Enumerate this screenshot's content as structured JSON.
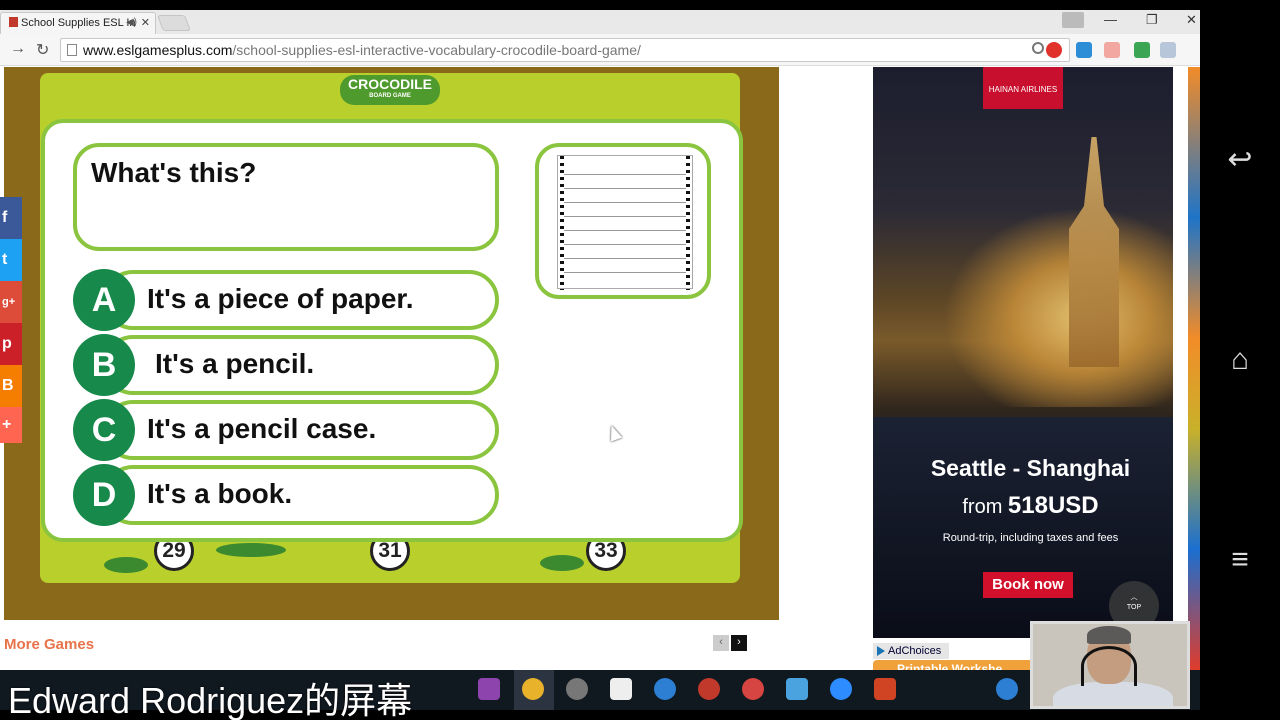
{
  "browser": {
    "tab_title": "School Supplies ESL In",
    "tab_close": "✕",
    "url_host": "www.eslgamesplus.com",
    "url_path": "/school-supplies-esl-interactive-vocabulary-crocodile-board-game/",
    "window_controls": [
      "—",
      "❐",
      "✕"
    ]
  },
  "game": {
    "logo_text": "CROCODILE",
    "logo_subtext": "BOARD GAME",
    "board_numbers": [
      "29",
      "31",
      "33"
    ],
    "question": "What's this?",
    "options": [
      {
        "letter": "A",
        "text": "It's a piece of paper."
      },
      {
        "letter": "B",
        "text": "It's a pencil."
      },
      {
        "letter": "C",
        "text": "It's a pencil case."
      },
      {
        "letter": "D",
        "text": "It's a book."
      }
    ]
  },
  "more_games": {
    "label": "More Games",
    "prev": "‹",
    "next": "›"
  },
  "share_bar": [
    {
      "icon": "facebook-icon",
      "glyph": "f",
      "color": "#3b5998"
    },
    {
      "icon": "twitter-icon",
      "glyph": "t",
      "color": "#1da1f2"
    },
    {
      "icon": "googleplus-icon",
      "glyph": "g+",
      "color": "#dd4b39"
    },
    {
      "icon": "pinterest-icon",
      "glyph": "p",
      "color": "#cb2027"
    },
    {
      "icon": "blogger-icon",
      "glyph": "B",
      "color": "#f57d00"
    },
    {
      "icon": "more-share-icon",
      "glyph": "+",
      "color": "#ff6550"
    }
  ],
  "ad": {
    "brand": "HAINAN AIRLINES",
    "route": "Seattle - Shanghai",
    "price_prefix": "from",
    "price": "518USD",
    "fine_print": "Round-trip, including taxes and fees",
    "cta": "Book now",
    "top_label": "TOP",
    "adchoices": "AdChoices",
    "printable": "Printable Workshe"
  },
  "caption": "Edward Rodriguez的屏幕",
  "android_nav": {
    "back": "↩",
    "home": "⌂",
    "menu": "≡"
  }
}
